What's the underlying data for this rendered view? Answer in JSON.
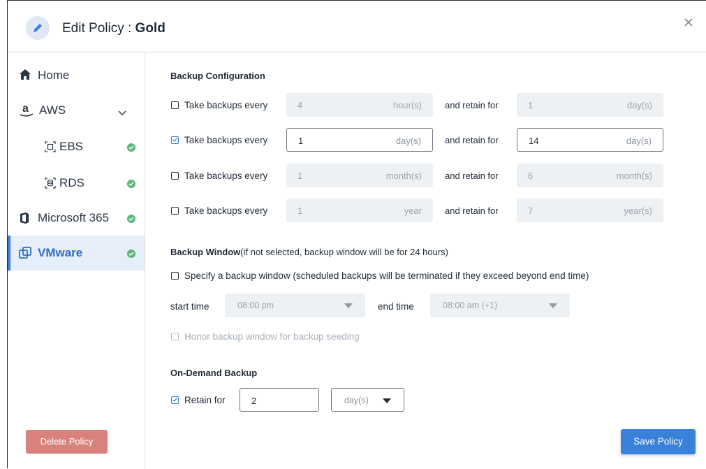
{
  "header": {
    "title_prefix": "Edit Policy : ",
    "policy_name": "Gold"
  },
  "sidebar": {
    "items": [
      {
        "label": "Home",
        "icon": "home-icon"
      },
      {
        "label": "AWS",
        "icon": "amazon-logo-icon",
        "expanded": true
      },
      {
        "label": "EBS",
        "icon": "ebs-volume-icon",
        "status": "configured"
      },
      {
        "label": "RDS",
        "icon": "rds-database-icon",
        "status": "configured"
      },
      {
        "label": "Microsoft 365",
        "icon": "office-logo-icon",
        "status": "configured"
      },
      {
        "label": "VMware",
        "icon": "vmware-icon",
        "status": "configured",
        "active": true
      }
    ],
    "delete_label": "Delete Policy"
  },
  "backup_config": {
    "title": "Backup Configuration",
    "rows": [
      {
        "checked": false,
        "label": "Take backups every",
        "every_value": "4",
        "every_unit": "hour(s)",
        "retain_label": "and retain for",
        "retain_value": "1",
        "retain_unit": "day(s)"
      },
      {
        "checked": true,
        "label": "Take backups every",
        "every_value": "1",
        "every_unit": "day(s)",
        "retain_label": "and retain for",
        "retain_value": "14",
        "retain_unit": "day(s)"
      },
      {
        "checked": false,
        "label": "Take backups every",
        "every_value": "1",
        "every_unit": "month(s)",
        "retain_label": "and retain for",
        "retain_value": "6",
        "retain_unit": "month(s)"
      },
      {
        "checked": false,
        "label": "Take backups every",
        "every_value": "1",
        "every_unit": "year",
        "retain_label": "and retain for",
        "retain_value": "7",
        "retain_unit": "year(s)"
      }
    ]
  },
  "backup_window": {
    "title": "Backup Window",
    "note": "(if not selected, backup window will be for 24 hours)",
    "specify_checked": false,
    "specify_label": "Specify a backup window (scheduled backups will be terminated if they exceed beyond end time)",
    "start_label": "start time",
    "start_value": "08:00 pm",
    "end_label": "end time",
    "end_value": "08:00 am (+1)",
    "honor_label": "Honor backup window for backup seeding",
    "honor_checked": false
  },
  "on_demand": {
    "title": "On-Demand Backup",
    "retain_checked": true,
    "retain_label": "Retain for",
    "retain_value": "2",
    "retain_unit": "day(s)"
  },
  "footer": {
    "save_label": "Save Policy"
  },
  "colors": {
    "accent": "#3a82d9",
    "success": "#5cb87a",
    "danger": "#d9817d",
    "active_nav_bg": "#e6eef9"
  }
}
